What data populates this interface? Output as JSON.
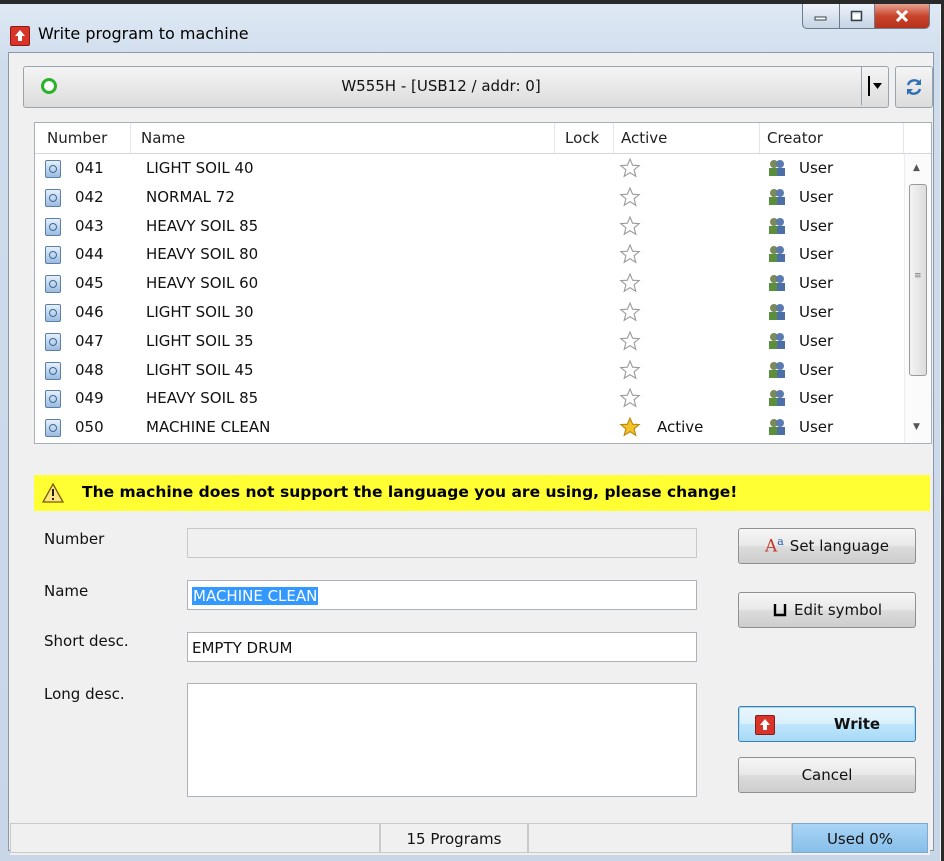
{
  "window": {
    "title": "Write program to machine"
  },
  "machine": {
    "label": "W555H - [USB12 / addr: 0]"
  },
  "list": {
    "columns": [
      "Number",
      "Name",
      "Lock",
      "Active",
      "Creator"
    ],
    "rows": [
      {
        "number": "041",
        "name": "LIGHT SOIL 40",
        "active": "",
        "creator": "User"
      },
      {
        "number": "042",
        "name": "NORMAL 72",
        "active": "",
        "creator": "User"
      },
      {
        "number": "043",
        "name": "HEAVY SOIL 85",
        "active": "",
        "creator": "User"
      },
      {
        "number": "044",
        "name": "HEAVY SOIL 80",
        "active": "",
        "creator": "User"
      },
      {
        "number": "045",
        "name": "HEAVY SOIL 60",
        "active": "",
        "creator": "User"
      },
      {
        "number": "046",
        "name": "LIGHT SOIL 30",
        "active": "",
        "creator": "User"
      },
      {
        "number": "047",
        "name": "LIGHT SOIL 35",
        "active": "",
        "creator": "User"
      },
      {
        "number": "048",
        "name": "LIGHT SOIL 45",
        "active": "",
        "creator": "User"
      },
      {
        "number": "049",
        "name": "HEAVY SOIL 85",
        "active": "",
        "creator": "User"
      },
      {
        "number": "050",
        "name": "MACHINE CLEAN",
        "active": "Active",
        "creator": "User"
      }
    ]
  },
  "warning": {
    "text": "The machine does not support the language you are using, please change!"
  },
  "form": {
    "number_label": "Number",
    "number_value": "",
    "name_label": "Name",
    "name_value": "MACHINE CLEAN",
    "short_label": "Short desc.",
    "short_value": "EMPTY DRUM",
    "long_label": "Long desc.",
    "long_value": ""
  },
  "buttons": {
    "set_language": "Set language",
    "edit_symbol": "Edit symbol",
    "write": "Write",
    "cancel": "Cancel"
  },
  "status": {
    "programs": "15 Programs",
    "used": "Used 0%"
  },
  "colors": {
    "warning_bg": "#ffff33",
    "status_online": "#29b22a",
    "used_bar": "#87bfe9"
  },
  "icons": {
    "title": "write-arrow-icon",
    "refresh": "refresh-icon",
    "program": "program-file-icon",
    "inactive_star": "star-outline-icon",
    "active_star": "star-filled-icon",
    "creator": "user-group-icon",
    "warning": "warning-triangle-icon"
  }
}
